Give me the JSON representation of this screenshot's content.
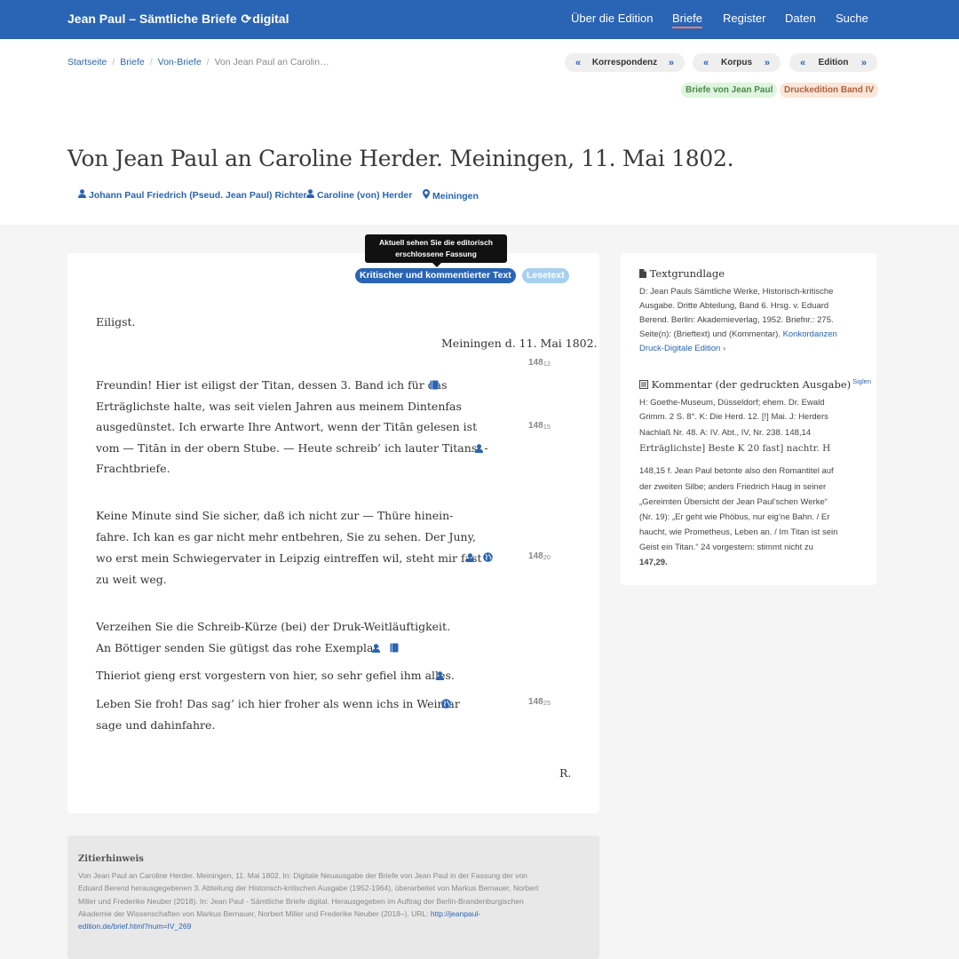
{
  "navbar": {
    "brand_prefix": "Jean Paul – Sämtliche Briefe",
    "brand_suffix": "digital",
    "items": [
      "Über die Edition",
      "Briefe",
      "Register",
      "Daten",
      "Suche"
    ]
  },
  "breadcrumb": [
    "Startseite",
    "Briefe",
    "Von-Briefe",
    "Von Jean Paul an Carolin…"
  ],
  "pagers": [
    "Korrespondenz",
    "Korpus",
    "Edition"
  ],
  "tags": [
    "Briefe von Jean Paul",
    "Druckedition Band IV"
  ],
  "title": "Von Jean Paul an Caroline Herder. Meiningen, 11. Mai 1802.",
  "meta": {
    "sender": "Johann Paul Friedrich (Pseud. Jean Paul) Richter",
    "recipient": "Caroline (von) Herder",
    "place": "Meiningen"
  },
  "tooltip": [
    "Aktuell sehen Sie die editorisch",
    "erschlossene Fassung"
  ],
  "toggles": [
    "Kritischer und kommentierter Text",
    "Lesetext"
  ],
  "letter": {
    "opening": "Eiligst.",
    "dateline": "Meiningen d. 11. Mai 1802.",
    "lines": [
      "Freundin! Hier ist eiligst der Titan, dessen 3. Band ich für das",
      "Erträglichste halte, was seit vielen Jahren aus meinem Dintenfas",
      "ausgedünstet. Ich erwarte Ihre Antwort, wenn der Titān gelesen ist",
      "vom — Titān in der obern Stube. — Heute schreib’ ich lauter Titans- -",
      "Frachtbriefe.",
      "Keine Minute sind Sie sicher, daß ich nicht zur — Thüre hinein-",
      "fahre. Ich kan es gar nicht mehr entbehren, Sie zu sehen. Der Juny,",
      "wo erst mein Schwiegervater in Leipzig eintreffen wil, steht mir fast",
      "zu weit weg.",
      "Verzeihen Sie die Schreib-Kürze (bei) der Druk-Weitläuftigkeit.",
      "An Böttiger senden Sie gütigst das rohe Exemplar.",
      "Thieriot gieng erst vorgestern von hier, so sehr gefiel ihm alles.",
      "Leben Sie froh! Das sag’ ich hier froher als wenn ichs in Weimar",
      "sage und dahinfahre."
    ],
    "signature": "R.",
    "line_numbers": [
      {
        "page": "148",
        "line": "12"
      },
      {
        "page": "148",
        "line": "15"
      },
      {
        "page": "148",
        "line": "20"
      },
      {
        "page": "148",
        "line": "25"
      }
    ]
  },
  "citation": {
    "heading": "Zitierhinweis",
    "lines": [
      "Von Jean Paul an Caroline Herder. Meiningen, 11. Mai 1802. In: Digitale Neuausgabe der Briefe von Jean Paul in der Fassung der von",
      "Eduard Berend herausgegebenen 3. Abteilung der Historisch-kritischen Ausgabe (1952-1964), überarbeitet von Markus Bernauer, Norbert",
      "Miller und Frederike Neuber (2018). In: Jean Paul - Sämtliche Briefe digital. Herausgegeben im Auftrag der Berlin-Brandenburgischen",
      "Akademie der Wissenschaften von Markus Bernauer, Norbert Miller und Frederike Neuber (2018–). URL:"
    ],
    "url_part1": "http://jeanpaul-",
    "url_part2": "edition.de/brief.html?num=IV_269"
  },
  "sidebar": {
    "textgrundlage_heading": "Textgrundlage",
    "textgrundlage_lines": [
      "D: Jean Pauls Sämtliche Werke, Historisch-kritische",
      "Ausgabe. Dritte Abteilung, Band 6. Hrsg. v. Eduard",
      "Berend. Berlin: Akademieverlag, 1952. Briefnr.: 275.",
      "Seite(n): (Brieftext) und (Kommentar)."
    ],
    "konkordanzen_link1": "Konkordanzen",
    "konkordanzen_link2": "Druck-Digitale Edition",
    "kommentar_heading": "Kommentar (der gedruckten Ausgabe)",
    "siglen": "Siglen",
    "kommentar_lines": [
      "H: Goethe-Museum, Düsseldorf; ehem. Dr. Ewald",
      "Grimm. 2 S. 8°. K: Die Herd. 12. [!] Mai. J: Herders",
      "Nachlaß Nr. 48. A: IV. Abt., IV, Nr. 238. 148,14",
      "Erträglichste] Beste K 20 fast] nachtr. H",
      "148,15 f. Jean Paul betonte also den Romantitel auf",
      "der zweiten Silbe; anders Friedrich Haug in seiner",
      "„Gereimten Übersicht der Jean Paul’schen Werke“",
      "(Nr. 19): „Er geht wie Phöbus, nur eig’ne Bahn. / Er",
      "haucht, wie Prometheus, Leben an. / Im Titan ist sein",
      "Geist ein Titan.“ 24 vorgestern: stimmt nicht zu",
      "147,29."
    ]
  },
  "colors": {
    "primary": "#2a64b5",
    "accent": "#ef7e5c"
  }
}
